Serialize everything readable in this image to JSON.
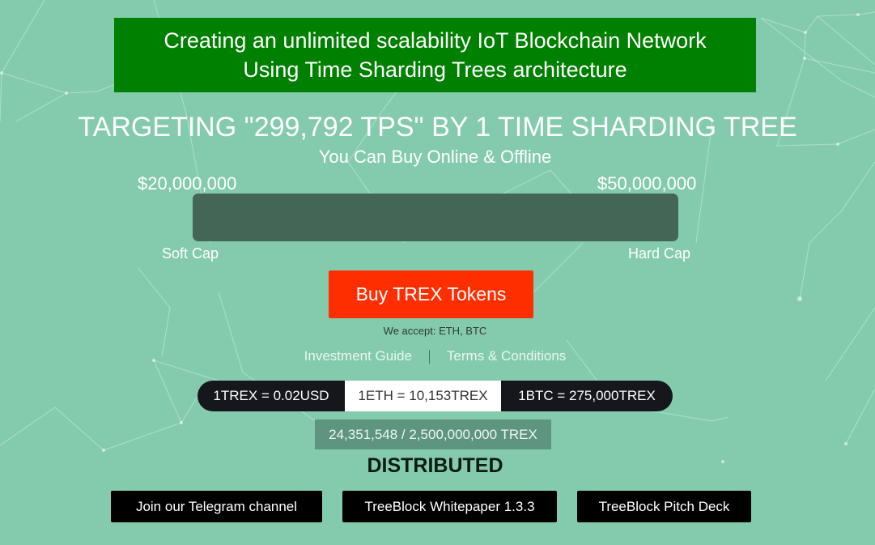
{
  "banner": {
    "line1": "Creating an unlimited scalability IoT Blockchain Network",
    "line2": "Using Time Sharding Trees architecture"
  },
  "headline": "TARGETING \"299,792 TPS\" BY 1 TIME SHARDING TREE",
  "subtitle": "You Can Buy Online & Offline",
  "funding": {
    "soft_cap_amount": "$20,000,000",
    "hard_cap_amount": "$50,000,000",
    "soft_cap_label": "Soft Cap",
    "hard_cap_label": "Hard Cap",
    "progress_percent": 0
  },
  "buy_button": "Buy TREX Tokens",
  "accept_text": "We accept: ETH, BTC",
  "links": {
    "investment_guide": "Investment Guide",
    "terms": "Terms & Conditions"
  },
  "rates": [
    "1TREX = 0.02USD",
    "1ETH = 10,153TREX",
    "1BTC = 275,000TREX"
  ],
  "distribution": {
    "count": "24,351,548 / 2,500,000,000 TREX",
    "label": "DISTRIBUTED"
  },
  "buttons": {
    "telegram": "Join our Telegram channel",
    "whitepaper": "TreeBlock Whitepaper 1.3.3",
    "pitch_deck": "TreeBlock Pitch Deck"
  },
  "colors": {
    "background": "#84cbae",
    "banner": "#008000",
    "buy_button": "#ff2e00",
    "progress_track": "#436656"
  }
}
